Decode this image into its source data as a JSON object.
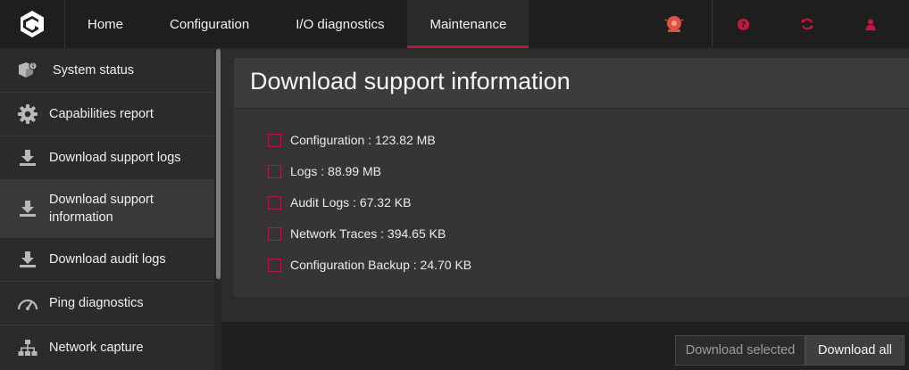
{
  "nav": {
    "items": [
      {
        "label": "Home"
      },
      {
        "label": "Configuration"
      },
      {
        "label": "I/O diagnostics"
      },
      {
        "label": "Maintenance"
      }
    ],
    "active_index": 3
  },
  "topbar": {
    "icons": [
      "alarm-icon",
      "help-icon",
      "refresh-icon",
      "user-icon"
    ],
    "accent_color": "#b5173e",
    "alarm_color": "#e0523f"
  },
  "sidebar": {
    "items": [
      {
        "label": "System status",
        "icon": "cube-info-icon"
      },
      {
        "label": "Capabilities report",
        "icon": "gear-icon"
      },
      {
        "label": "Download support logs",
        "icon": "download-icon"
      },
      {
        "label": "Download support information",
        "icon": "download-icon"
      },
      {
        "label": "Download audit logs",
        "icon": "download-icon"
      },
      {
        "label": "Ping diagnostics",
        "icon": "gauge-icon"
      },
      {
        "label": "Network capture",
        "icon": "network-icon"
      }
    ],
    "active_index": 3
  },
  "main": {
    "title": "Download support information",
    "options": [
      {
        "label": "Configuration : 123.82 MB",
        "checked": false
      },
      {
        "label": "Logs : 88.99 MB",
        "checked": false
      },
      {
        "label": "Audit Logs : 67.32 KB",
        "checked": false
      },
      {
        "label": "Network Traces : 394.65 KB",
        "checked": false
      },
      {
        "label": "Configuration Backup : 24.70 KB",
        "checked": false
      }
    ]
  },
  "footer": {
    "download_selected_label": "Download selected",
    "download_all_label": "Download all"
  }
}
